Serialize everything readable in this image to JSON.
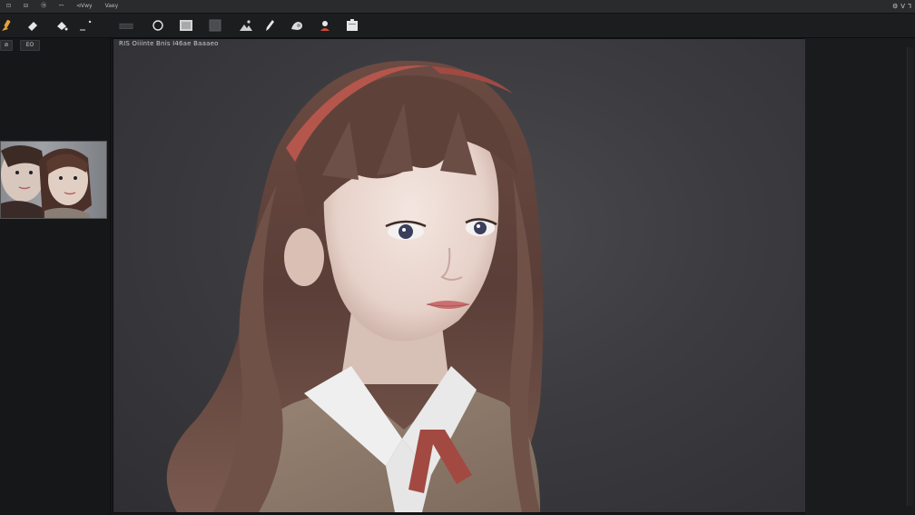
{
  "menubar": {
    "items": [
      "⊡",
      "⊟",
      "⑮",
      "ꟷ",
      "⊲Vwy",
      "Vaey"
    ],
    "right_glyphs": [
      "⚙",
      "V",
      "Ꞁ"
    ]
  },
  "toolbar": {
    "tools": [
      {
        "name": "brush-tool-icon",
        "color": "#e9a23b"
      },
      {
        "name": "eraser-tool-icon",
        "color": "#e0e0e0"
      },
      {
        "name": "paint-bucket-tool-icon",
        "color": "#e0e0e0"
      },
      {
        "name": "line-tool-icon",
        "color": "#e0e0e0"
      },
      {
        "name": "rectangle-tool-icon",
        "color": "#555"
      },
      {
        "name": "ellipse-tool-icon",
        "color": "#e0e0e0"
      },
      {
        "name": "frame-tool-icon",
        "color": "#d8d8d8"
      },
      {
        "name": "layer-tool-icon",
        "color": "#666"
      },
      {
        "name": "landscape-tool-icon",
        "color": "#ccc"
      },
      {
        "name": "pen-tool-icon",
        "color": "#e0e0e0"
      },
      {
        "name": "smudge-tool-icon",
        "color": "#e0e0e0"
      },
      {
        "name": "person-tool-icon",
        "color": "#e0e0e0"
      },
      {
        "name": "clipboard-tool-icon",
        "color": "#e0e0e0"
      }
    ]
  },
  "left_panel": {
    "buttons": [
      "⊘",
      "ЕО"
    ],
    "thumbnail_alt_icon": "thumbnail-portrait"
  },
  "canvas": {
    "caption": "RIS Oiiinte Bnis I46ae Baaaeo"
  },
  "colors": {
    "background": "#161718",
    "canvas_bg": "#3c3c40",
    "accent": "#e9a23b"
  }
}
